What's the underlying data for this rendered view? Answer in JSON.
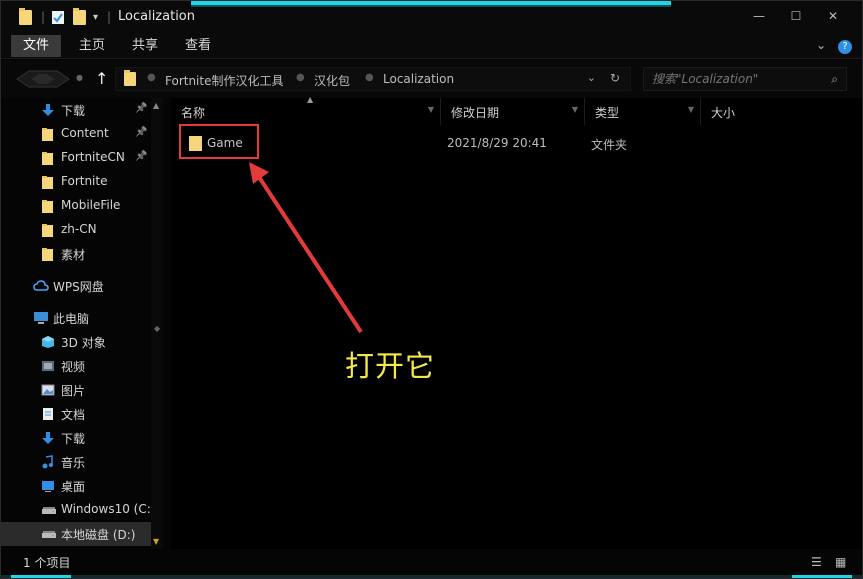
{
  "window": {
    "title": "Localization"
  },
  "ribbon": {
    "tabs": [
      "文件",
      "主页",
      "共享",
      "查看"
    ],
    "active_tab": "文件"
  },
  "address": {
    "crumbs": [
      "Fortnite制作汉化工具",
      "汉化包",
      "Localization"
    ]
  },
  "search": {
    "placeholder": "搜索\"Localization\""
  },
  "nav": {
    "items": [
      {
        "label": "下载",
        "icon": "download-arrow-icon",
        "pinned": true
      },
      {
        "label": "Content",
        "icon": "folder-icon",
        "pinned": true
      },
      {
        "label": "FortniteCN",
        "icon": "folder-icon",
        "pinned": true
      },
      {
        "label": "Fortnite",
        "icon": "folder-icon",
        "pinned": false
      },
      {
        "label": "MobileFile",
        "icon": "folder-icon",
        "pinned": false
      },
      {
        "label": "zh-CN",
        "icon": "folder-icon",
        "pinned": false
      },
      {
        "label": "素材",
        "icon": "folder-icon",
        "pinned": false
      },
      {
        "label": "WPS网盘",
        "icon": "cloud-icon",
        "pinned": false
      },
      {
        "label": "此电脑",
        "icon": "computer-icon",
        "pinned": false
      },
      {
        "label": "3D 对象",
        "icon": "cube-icon",
        "pinned": false
      },
      {
        "label": "视频",
        "icon": "video-icon",
        "pinned": false
      },
      {
        "label": "图片",
        "icon": "picture-icon",
        "pinned": false
      },
      {
        "label": "文档",
        "icon": "document-icon",
        "pinned": false
      },
      {
        "label": "下载",
        "icon": "download-arrow-icon",
        "pinned": false
      },
      {
        "label": "音乐",
        "icon": "music-note-icon",
        "pinned": false
      },
      {
        "label": "桌面",
        "icon": "desktop-icon",
        "pinned": false
      },
      {
        "label": "Windows10 (C:",
        "icon": "drive-icon",
        "pinned": false
      },
      {
        "label": "本地磁盘 (D:)",
        "icon": "drive-icon",
        "pinned": false
      }
    ]
  },
  "columns": [
    {
      "label": "名称"
    },
    {
      "label": "修改日期"
    },
    {
      "label": "类型"
    },
    {
      "label": "大小"
    }
  ],
  "files": [
    {
      "name": "Game",
      "date": "2021/8/29 20:41",
      "type": "文件夹"
    }
  ],
  "annotation": {
    "text": "打开它",
    "color": "#f2e84a",
    "box_color": "#e53a3a"
  },
  "status": {
    "count": "1 个项目"
  },
  "colors": {
    "accent": "#1fd6e8",
    "folder": "#f5d67b"
  }
}
